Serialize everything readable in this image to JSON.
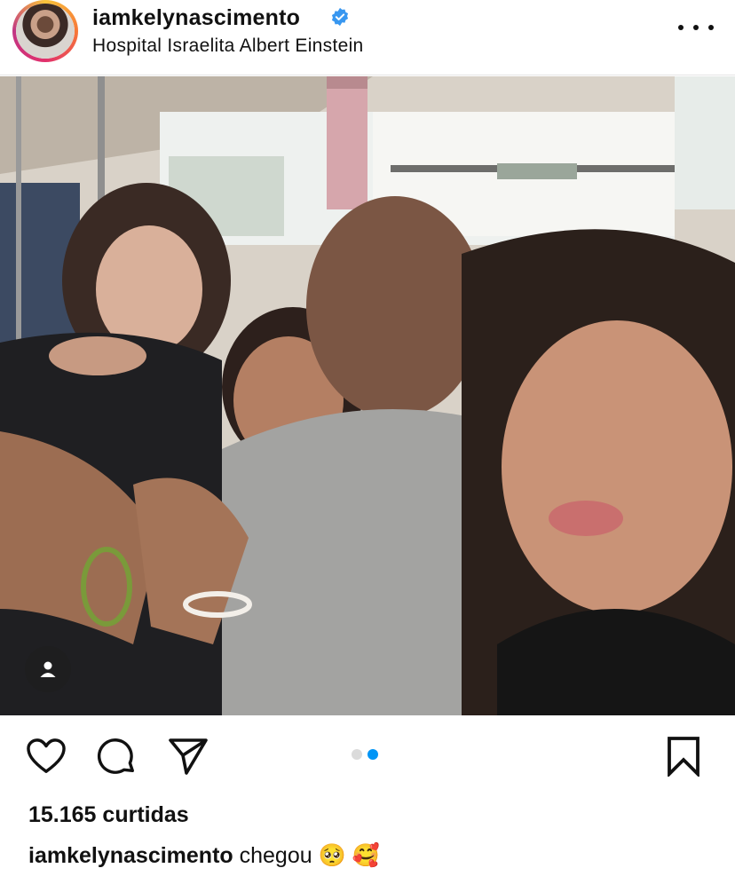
{
  "post": {
    "username": "iamkelynascimento",
    "location": "Hospital Israelita Albert Einstein",
    "verified": true,
    "likes_text": "15.165 curtidas",
    "caption_user": "iamkelynascimento",
    "caption_text": "chegou",
    "caption_emojis": "🥺 🥰",
    "carousel": {
      "total": 2,
      "active": 2
    }
  },
  "colors": {
    "verified_badge": "#3897f0",
    "active_dot": "#0095f6",
    "inactive_dot": "#dbdbdb"
  },
  "icons": {
    "more": "more-options-icon",
    "heart": "heart-icon",
    "comment": "comment-icon",
    "share": "share-paper-plane-icon",
    "save": "bookmark-icon",
    "tag": "user-tag-icon"
  }
}
